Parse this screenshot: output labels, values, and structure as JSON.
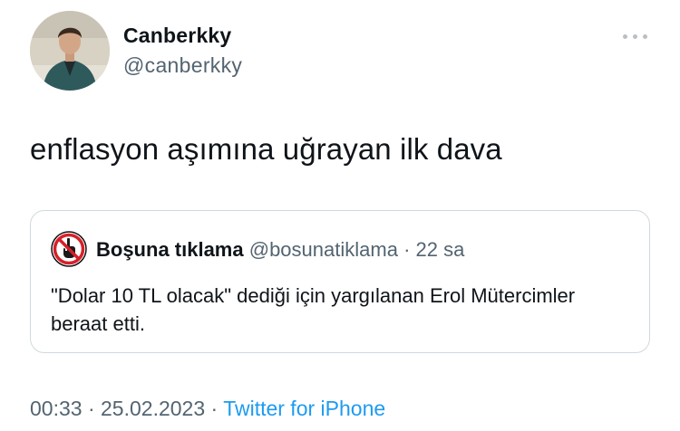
{
  "author": {
    "display_name": "Canberkky",
    "handle": "@canberkky"
  },
  "tweet": {
    "text": "enflasyon aşımına uğrayan ilk dava"
  },
  "quoted_tweet": {
    "display_name": "Boşuna tıklama",
    "handle": "@bosunatiklama",
    "separator": "·",
    "time_ago": "22 sa",
    "text": "\"Dolar 10 TL olacak\" dediği için yargılanan Erol Mütercimler beraat etti."
  },
  "footer": {
    "time": "00:33",
    "separator": "·",
    "date": "25.02.2023",
    "source": "Twitter for iPhone"
  },
  "icons": {
    "more": "more-horizontal-icon",
    "quote_avatar": "no-pointing-hand-icon"
  },
  "colors": {
    "text_primary": "#0f1419",
    "text_secondary": "#536471",
    "link": "#1d9bf0",
    "border": "#cfd9de"
  }
}
